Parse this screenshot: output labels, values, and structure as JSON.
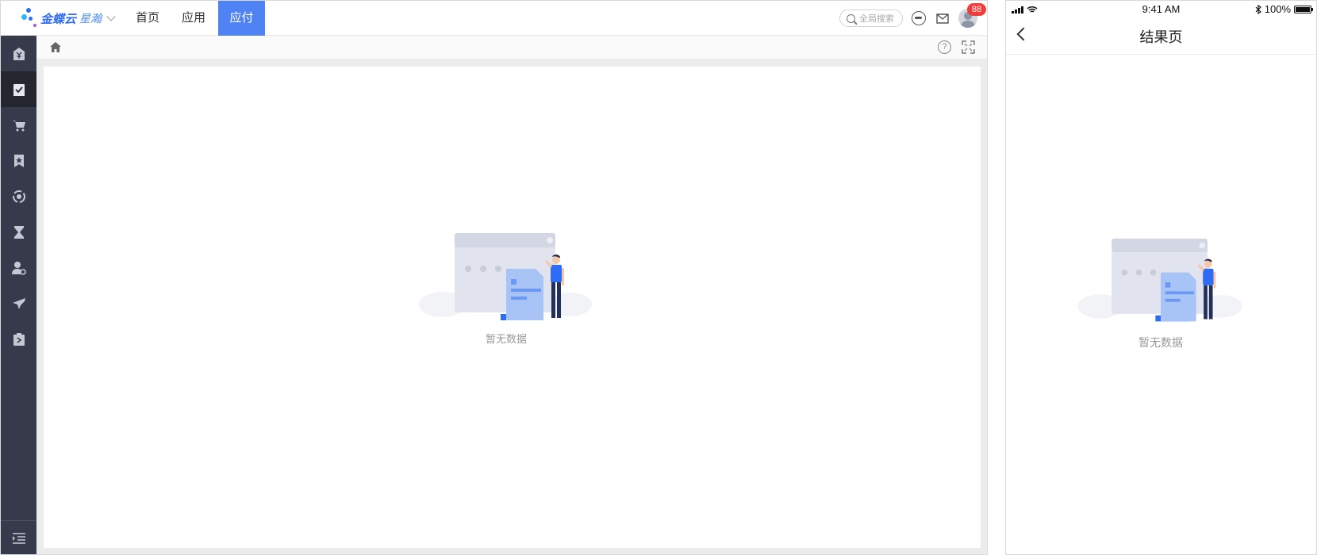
{
  "desktop": {
    "logo": {
      "brand": "金蝶云",
      "product": "星瀚"
    },
    "nav": [
      {
        "label": "首页",
        "active": false
      },
      {
        "label": "应用",
        "active": false
      },
      {
        "label": "应付",
        "active": true
      }
    ],
    "search": {
      "placeholder": "全局搜索"
    },
    "notifications": {
      "badge": "88"
    },
    "sidebar": {
      "items": [
        {
          "icon": "finance-icon",
          "active": false
        },
        {
          "icon": "approval-icon",
          "active": true
        },
        {
          "icon": "cart-icon",
          "active": false
        },
        {
          "icon": "bookmark-star-icon",
          "active": false
        },
        {
          "icon": "cycle-icon",
          "active": false
        },
        {
          "icon": "hourglass-icon",
          "active": false
        },
        {
          "icon": "user-settings-icon",
          "active": false
        },
        {
          "icon": "airplane-icon",
          "active": false
        },
        {
          "icon": "expense-icon",
          "active": false
        }
      ],
      "bottom_icon": "collapse-menu-icon"
    },
    "breadcrumb": {
      "home_icon": "home-icon",
      "help_icon": "help-icon",
      "fullscreen_icon": "fullscreen-icon"
    },
    "empty_text": "暂无数据",
    "colors": {
      "accent": "#4e82f5",
      "sidebar": "#373a4a",
      "badge": "#f23c3c"
    }
  },
  "mobile": {
    "status": {
      "time": "9:41 AM",
      "battery": "100%"
    },
    "title": "结果页",
    "empty_text": "暂无数据"
  }
}
